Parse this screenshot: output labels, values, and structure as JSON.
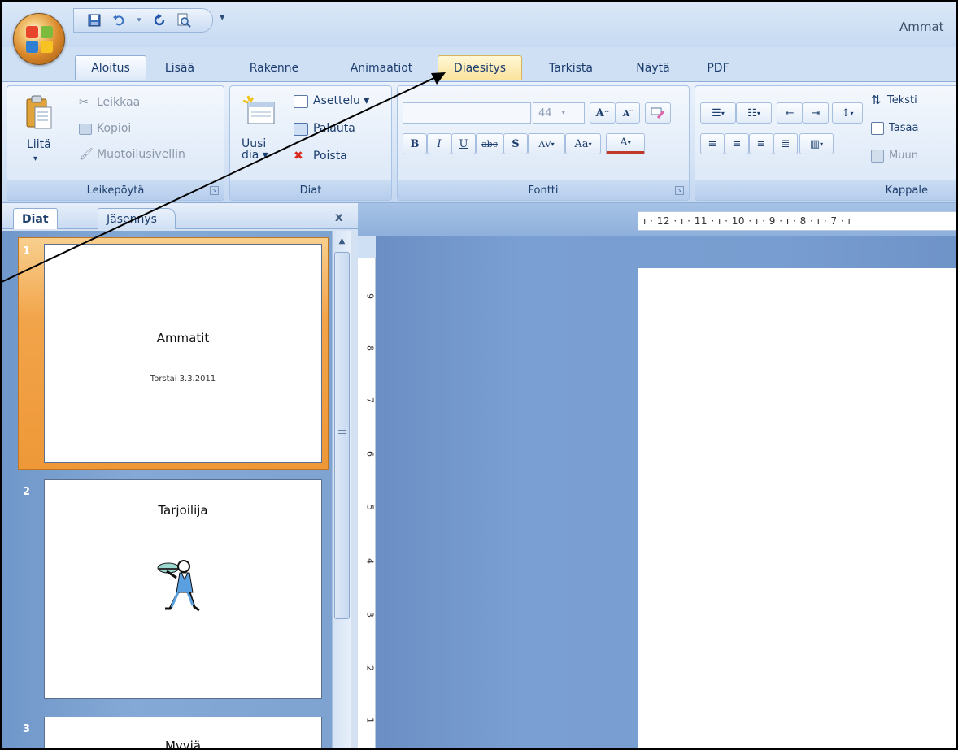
{
  "window": {
    "title": "Ammat"
  },
  "qat": {
    "save": "save-icon",
    "undo": "undo-icon",
    "redo": "redo-icon",
    "preview": "print-preview-icon",
    "more": "▾"
  },
  "tabs": [
    "Aloitus",
    "Lisää",
    "Rakenne",
    "Animaatiot",
    "Diaesitys",
    "Tarkista",
    "Näytä",
    "PDF"
  ],
  "ribbon": {
    "clipboard": {
      "label": "Leikepöytä",
      "paste": "Liitä",
      "cut": "Leikkaa",
      "copy": "Kopioi",
      "format": "Muotoilusivellin"
    },
    "slides": {
      "label": "Diat",
      "new_line1": "Uusi",
      "new_line2": "dia ▾",
      "layout": "Asettelu ▾",
      "reset": "Palauta",
      "delete": "Poista"
    },
    "font": {
      "label": "Fontti",
      "size": "44",
      "bold": "B",
      "italic": "I",
      "underline": "U",
      "strike": "abc",
      "shadow": "S",
      "spacing": "AV",
      "case": "Aa",
      "color": "A"
    },
    "paragraph": {
      "label": "Kappale",
      "text_dir": "Teksti",
      "align_text": "Tasaa",
      "convert": "Muun"
    }
  },
  "pane": {
    "tab_slides": "Diat",
    "tab_outline": "Jäsennys",
    "close": "x"
  },
  "slides": [
    {
      "num": "1",
      "title": "Ammatit",
      "subtitle": "Torstai 3.3.2011"
    },
    {
      "num": "2",
      "title": "Tarjoilija",
      "image": "waiter-clipart"
    },
    {
      "num": "3",
      "title": "Myyjä"
    }
  ],
  "ruler": {
    "horizontal": "ı · 12 · ı · 11 · ı · 10 · ı · 9 · ı · 8 · ı · 7 · ı",
    "vertical": [
      "9",
      "8",
      "7",
      "6",
      "5",
      "4",
      "3",
      "2",
      "1"
    ]
  },
  "colors": {
    "accent": "#ee9838",
    "ribbon": "#d3e2f5",
    "canvas": "#789dd0"
  }
}
